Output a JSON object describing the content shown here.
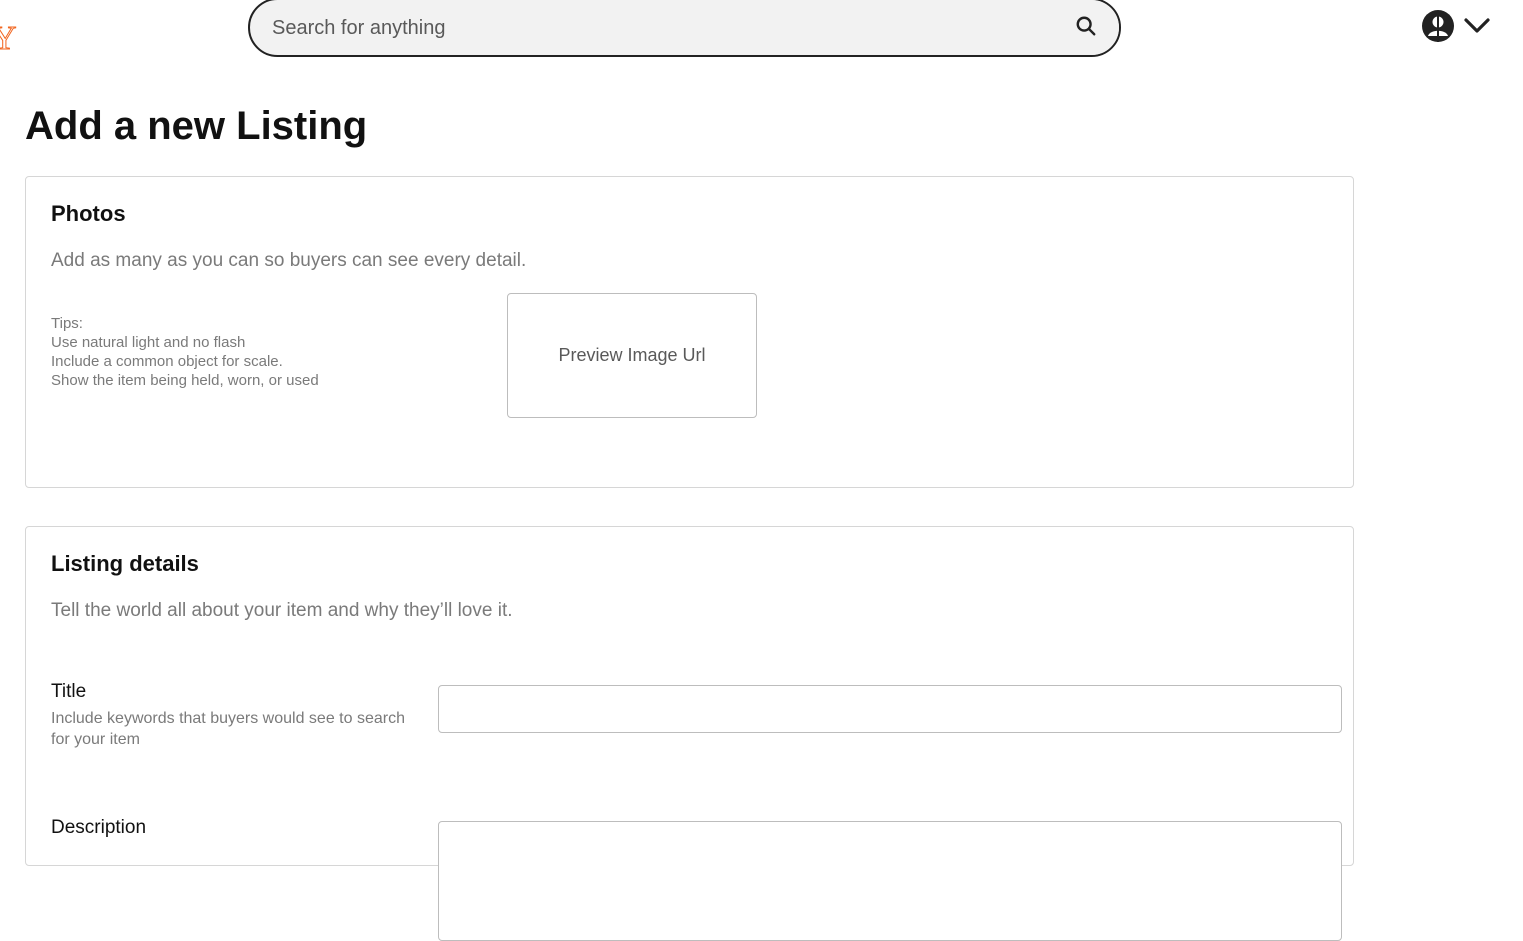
{
  "header": {
    "logo_fragment": "Y",
    "search": {
      "placeholder": "Search for anything",
      "value": ""
    },
    "icons": {
      "search": "search-icon",
      "account": "user-avatar-icon",
      "menu": "chevron-down-icon"
    }
  },
  "page": {
    "title": "Add a new Listing"
  },
  "photos": {
    "title": "Photos",
    "subtitle": "Add as many as you can so buyers can see every detail.",
    "tips": [
      "Tips:",
      "Use natural light and no flash",
      "Include a common object for scale.",
      "Show the item being held, worn, or used"
    ],
    "preview_label": "Preview Image Url"
  },
  "details": {
    "title": "Listing details",
    "subtitle": "Tell the world all about your item and why they’ll love it.",
    "title_field": {
      "label": "Title",
      "help": "Include keywords that buyers would see to search for your item",
      "value": ""
    },
    "description_field": {
      "label": "Description",
      "value": ""
    }
  },
  "colors": {
    "brand": "#f1641e",
    "text": "#111111",
    "muted": "#7a7a7a",
    "border": "#d6d6d6"
  }
}
